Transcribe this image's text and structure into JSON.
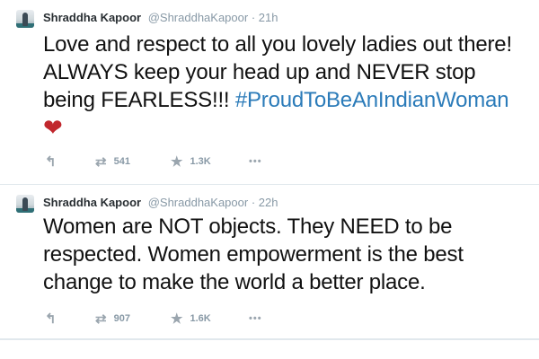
{
  "tweets": [
    {
      "author": "Shraddha Kapoor",
      "handle": "@ShraddhaKapoor",
      "separator": "·",
      "time": "21h",
      "text": "Love and respect to all you lovely ladies out there! ALWAYS keep your head up and NEVER stop being FEARLESS!!!",
      "hashtag": "#ProudToBeAnIndianWoman",
      "emoji": "❤",
      "retweets": "541",
      "favorites": "1.3K"
    },
    {
      "author": "Shraddha Kapoor",
      "handle": "@ShraddhaKapoor",
      "separator": "·",
      "time": "22h",
      "text": "Women are NOT objects. They NEED to be respected. Women empowerment is the best change to make the world a better place.",
      "retweets": "907",
      "favorites": "1.6K"
    }
  ],
  "icons": {
    "reply": "reply-icon",
    "retweet": "retweet-icon",
    "favorite": "star-icon",
    "more": "more-icon"
  },
  "colors": {
    "hashtag": "#2b7bb9",
    "heart": "#c1272d",
    "meta": "#8899a6"
  }
}
